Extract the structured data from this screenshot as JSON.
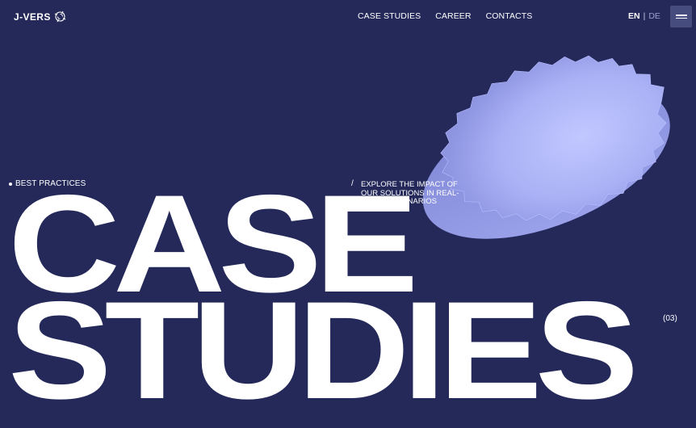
{
  "brand": {
    "name": "J-VERS",
    "logo_icon": "spiral-icon"
  },
  "nav": {
    "items": [
      {
        "label": "CASE STUDIES"
      },
      {
        "label": "CAREER"
      },
      {
        "label": "CONTACTS"
      }
    ]
  },
  "lang": {
    "active": "EN",
    "separator": "|",
    "inactive": "DE"
  },
  "menu": {
    "icon": "hamburger-icon"
  },
  "hero": {
    "eyebrow": "BEST PRACTICES",
    "slash": "/",
    "description": "EXPLORE THE IMPACT OF OUR SOLUTIONS IN REAL-WORLD SCENARIOS",
    "title_line1": "CASE",
    "title_line2": "STUDIES",
    "count": "(03)"
  },
  "colors": {
    "background": "#24295a",
    "shape": "#aab1f5",
    "text": "#ffffff"
  }
}
